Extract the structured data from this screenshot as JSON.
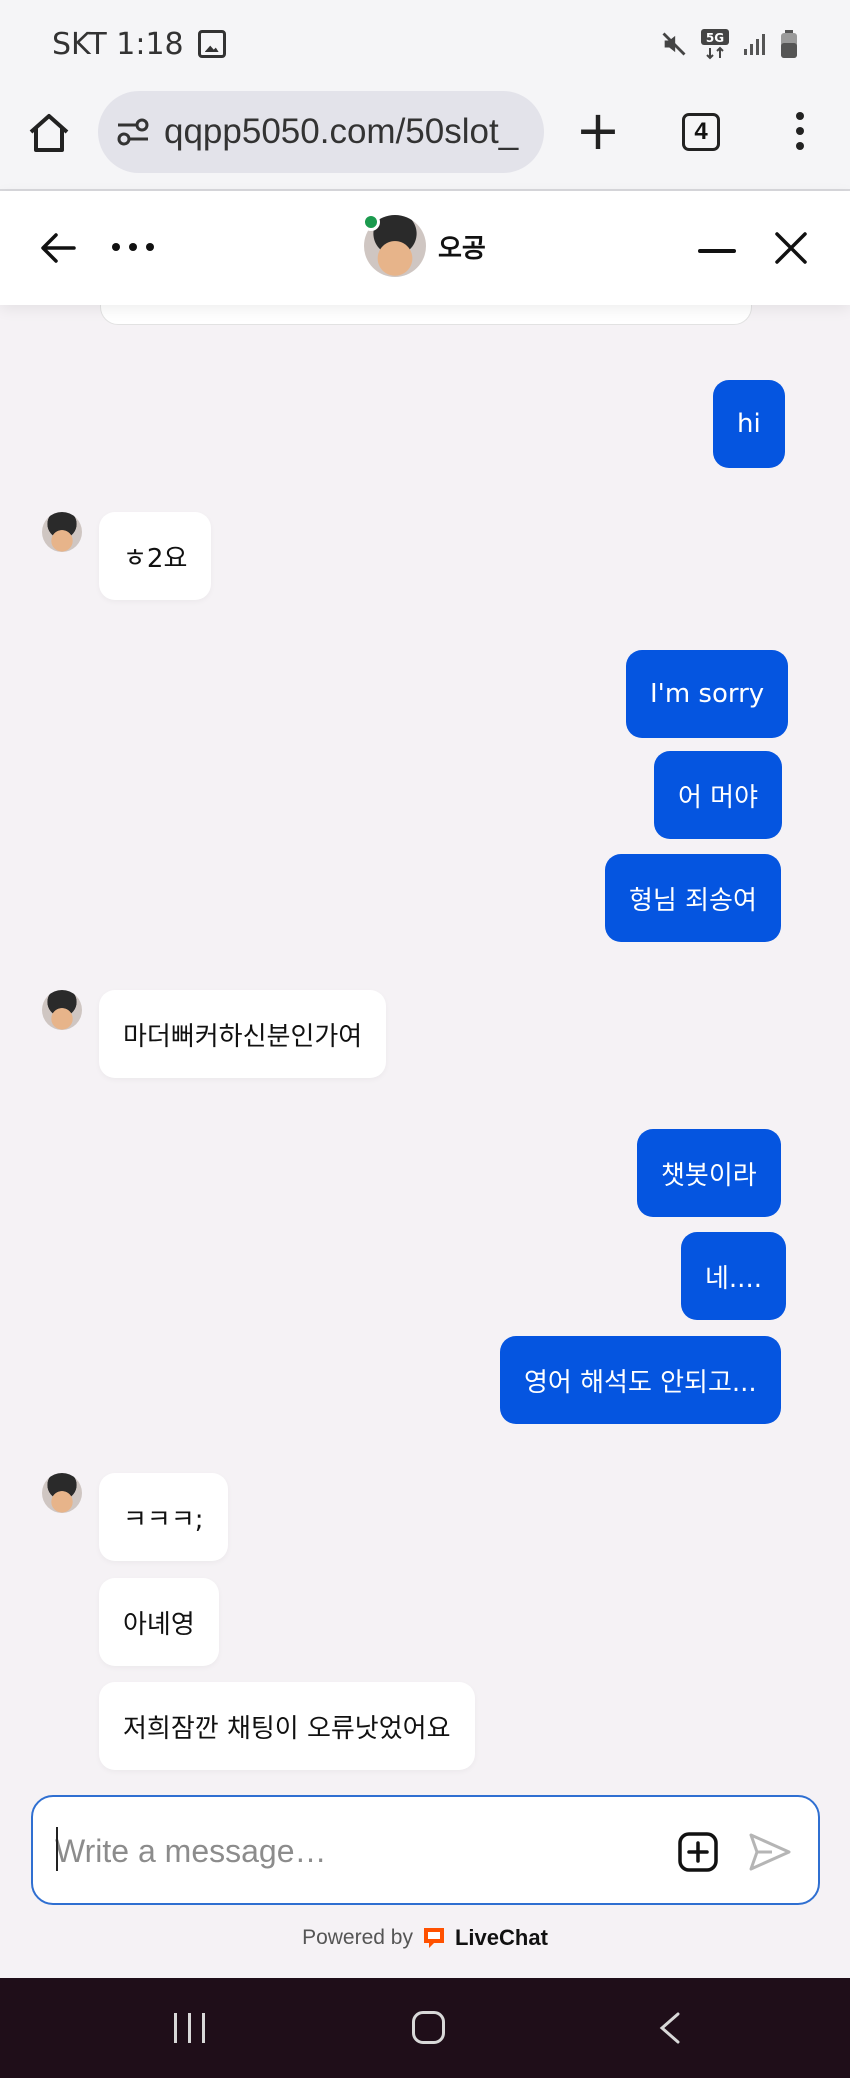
{
  "status_bar": {
    "carrier_time": "SKT 1:18",
    "icons": [
      "gallery-icon",
      "mute-icon",
      "5g-icon",
      "signal-icon",
      "battery-icon"
    ]
  },
  "browser": {
    "url": "qqpp5050.com/50slot_",
    "tab_count": "4"
  },
  "chat_header": {
    "agent_name": "오공",
    "online_color": "#1b9a4e"
  },
  "messages": [
    {
      "side": "out",
      "text": "hi"
    },
    {
      "side": "in",
      "text": "ㅎ2요"
    },
    {
      "side": "out",
      "text": "I'm sorry"
    },
    {
      "side": "out",
      "text": "어 머야"
    },
    {
      "side": "out",
      "text": "형님 죄송여"
    },
    {
      "side": "in",
      "text": "마더뻐커하신분인가여"
    },
    {
      "side": "out",
      "text": "챗봇이라"
    },
    {
      "side": "out",
      "text": "네...."
    },
    {
      "side": "out",
      "text": "영어 해석도 안되고..."
    },
    {
      "side": "in",
      "text": "ㅋㅋㅋ;"
    },
    {
      "side": "in",
      "text": "아녜영"
    },
    {
      "side": "in",
      "text": "저희잠깐 채팅이 오류낫었어요"
    }
  ],
  "composer": {
    "placeholder": "Write a message…"
  },
  "footer": {
    "powered_by": "Powered by",
    "brand": "LiveChat"
  },
  "colors": {
    "outgoing_bubble": "#0555e0",
    "incoming_bubble": "#ffffff",
    "brand_orange": "#ff5100"
  }
}
